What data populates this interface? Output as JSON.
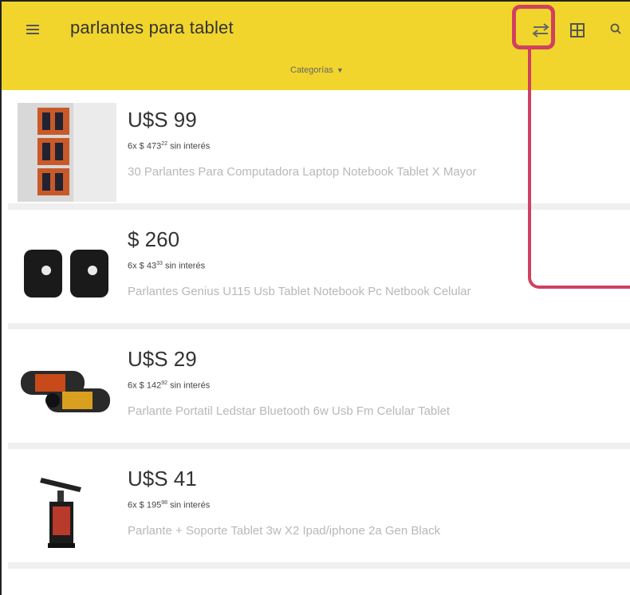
{
  "header": {
    "search_query": "parlantes para tablet",
    "category_label": "Categorías",
    "bg_color": "#f1d52c",
    "icons": [
      "menu-icon",
      "filter-icon",
      "layout-icon",
      "search-icon"
    ]
  },
  "annotation": {
    "color": "#d04060"
  },
  "results": [
    {
      "price": "U$S 99",
      "installments": {
        "prefix": "6x $ 473",
        "cents": "22",
        "suffix": "sin interés"
      },
      "title": "30 Parlantes Para Computadora Laptop Notebook Tablet X Mayor"
    },
    {
      "price": "$ 260",
      "installments": {
        "prefix": "6x $ 43",
        "cents": "33",
        "suffix": "sin interés"
      },
      "title": "Parlantes Genius U115 Usb Tablet Notebook Pc Netbook Celular"
    },
    {
      "price": "U$S 29",
      "installments": {
        "prefix": "6x $ 142",
        "cents": "92",
        "suffix": "sin interés"
      },
      "title": "Parlante Portatil Ledstar Bluetooth 6w Usb Fm Celular Tablet"
    },
    {
      "price": "U$S 41",
      "installments": {
        "prefix": "6x $ 195",
        "cents": "98",
        "suffix": "sin interés"
      },
      "title": "Parlante + Soporte Tablet 3w X2 Ipad/iphone 2a Gen Black"
    }
  ]
}
